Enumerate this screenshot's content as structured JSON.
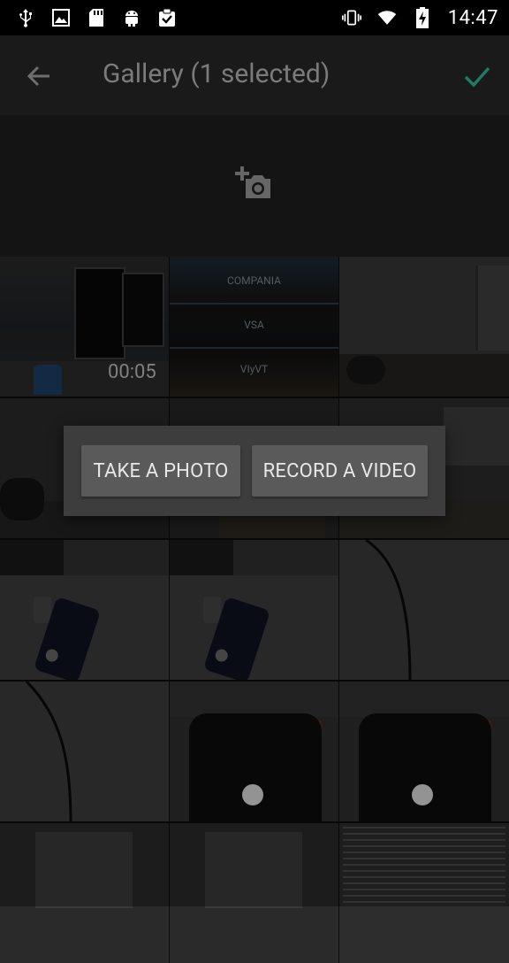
{
  "status_bar": {
    "time": "14:47",
    "left_icons": [
      "usb-icon",
      "image-icon",
      "sd-card-icon",
      "android-icon",
      "clipboard-check-icon"
    ],
    "right_icons": [
      "vibrate-icon",
      "wifi-icon",
      "battery-charging-icon"
    ]
  },
  "app_bar": {
    "title": "Gallery (1 selected)",
    "back_icon": "arrow-back-icon",
    "confirm_icon": "check-icon",
    "confirm_color": "#1f7a66"
  },
  "camera_tile": {
    "icon": "add-photo-icon"
  },
  "gallery": {
    "items": [
      {
        "type": "video",
        "duration": "00:05"
      },
      {
        "type": "image",
        "labels": [
          "COMPANIA",
          "VSA",
          "VIyVT"
        ]
      },
      {
        "type": "image"
      },
      {
        "type": "image"
      },
      {
        "type": "image"
      },
      {
        "type": "image"
      },
      {
        "type": "image"
      },
      {
        "type": "image"
      },
      {
        "type": "image"
      },
      {
        "type": "image"
      },
      {
        "type": "image"
      },
      {
        "type": "image"
      },
      {
        "type": "image"
      },
      {
        "type": "image"
      },
      {
        "type": "image"
      }
    ]
  },
  "dialog": {
    "take_photo_label": "TAKE A PHOTO",
    "record_video_label": "RECORD A VIDEO"
  }
}
